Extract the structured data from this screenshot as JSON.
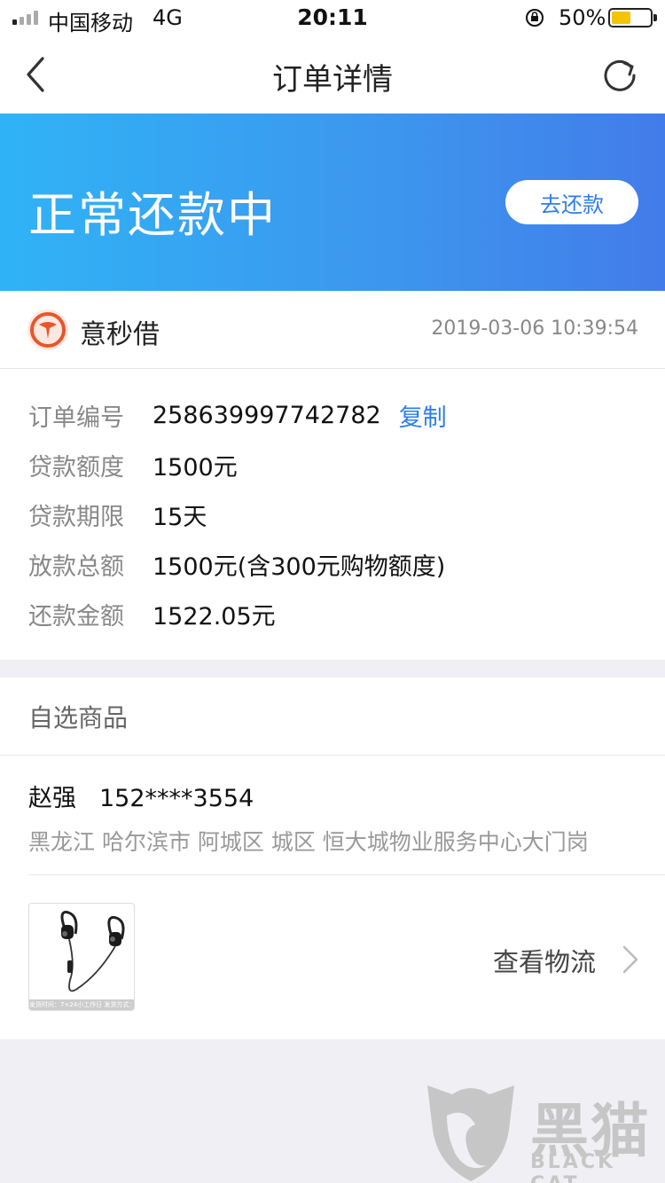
{
  "status_bar": {
    "carrier": "中国移动",
    "network": "4G",
    "time": "20:11",
    "battery_percent": "50%",
    "battery_level": 0.5,
    "battery_color": "#f5c400"
  },
  "nav": {
    "back_icon": "chevron-left-icon",
    "title": "订单详情",
    "refresh_icon": "refresh-icon"
  },
  "banner": {
    "status": "正常还款中",
    "repay_button": "去还款",
    "gradient_start": "#30b3f6",
    "gradient_end": "#427cea"
  },
  "merchant": {
    "name": "意秒借",
    "time": "2019-03-06 10:39:54",
    "logo_color": "#e8552a"
  },
  "order_info": {
    "order_no_label": "订单编号",
    "order_no": "258639997742782",
    "copy_label": "复制",
    "amount_label": "贷款额度",
    "amount": "1500元",
    "term_label": "贷款期限",
    "term": "15天",
    "disbursed_label": "放款总额",
    "disbursed": "1500元(含300元购物额度)",
    "repay_label": "还款金额",
    "repay": "1522.05元"
  },
  "product": {
    "header": "自选商品",
    "recipient_name": "赵强",
    "recipient_phone": "152****3554",
    "address": "黑龙江 哈尔滨市 阿城区 城区 恒大城物业服务中心大门岗",
    "thumb_caption": "发货时间：7×24小工作日  发货方式：快递",
    "logistics_label": "查看物流"
  },
  "watermark": {
    "text": "黑猫",
    "sub": "BLACK CAT"
  },
  "accent_color": "#2f7ee8"
}
